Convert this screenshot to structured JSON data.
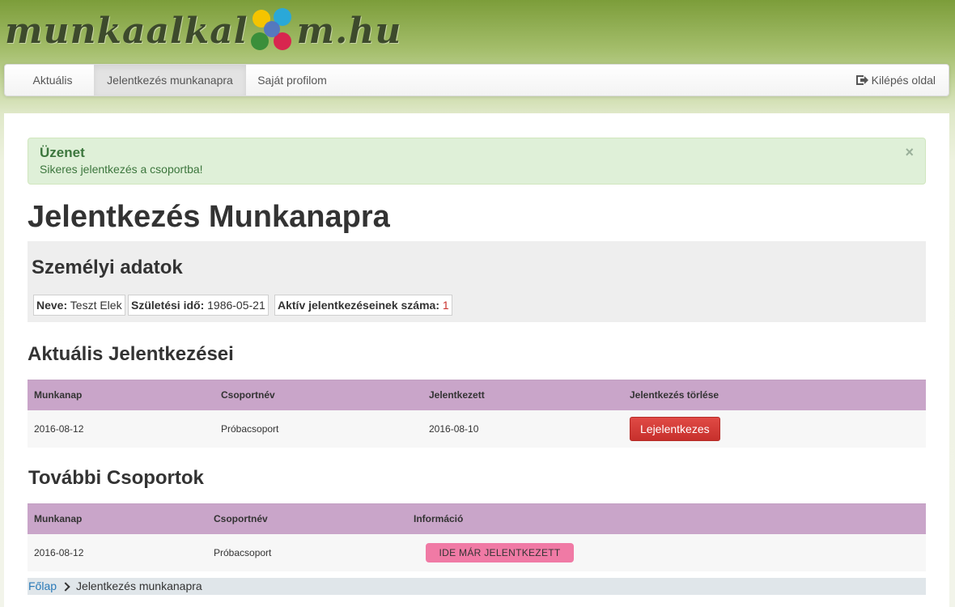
{
  "logo": {
    "left_text": "munkaalkal",
    "right_text": "m.hu"
  },
  "nav": {
    "items": [
      {
        "label": "Aktuális"
      },
      {
        "label": "Jelentkezés munkanapra"
      },
      {
        "label": "Saját profilom"
      }
    ],
    "exit_label": "Kilépés oldal"
  },
  "alert": {
    "title": "Üzenet",
    "message": "Sikeres jelentkezés a csoportba!",
    "close": "×"
  },
  "page": {
    "title": "Jelentkezés Munkanapra"
  },
  "personal": {
    "title": "Személyi adatok",
    "name_label": "Neve:",
    "name_value": "Teszt Elek",
    "birth_label": "Születési idő:",
    "birth_value": "1986-05-21",
    "count_label": "Aktív jelentkezéseinek száma:",
    "count_value": "1"
  },
  "current": {
    "title": "Aktuális Jelentkezései",
    "headers": [
      "Munkanap",
      "Csoportnév",
      "Jelentkezett",
      "Jelentkezés törlése"
    ],
    "rows": [
      {
        "day": "2016-08-12",
        "group": "Próbacsoport",
        "applied": "2016-08-10",
        "action": "Lejelentkezes"
      }
    ]
  },
  "other": {
    "title": "További Csoportok",
    "headers": [
      "Munkanap",
      "Csoportnév",
      "Információ"
    ],
    "rows": [
      {
        "day": "2016-08-12",
        "group": "Próbacsoport",
        "info": "IDE MÁR JELENTKEZETT"
      }
    ]
  },
  "breadcrumb": {
    "home": "Főlap",
    "current": "Jelentkezés munkanapra"
  }
}
